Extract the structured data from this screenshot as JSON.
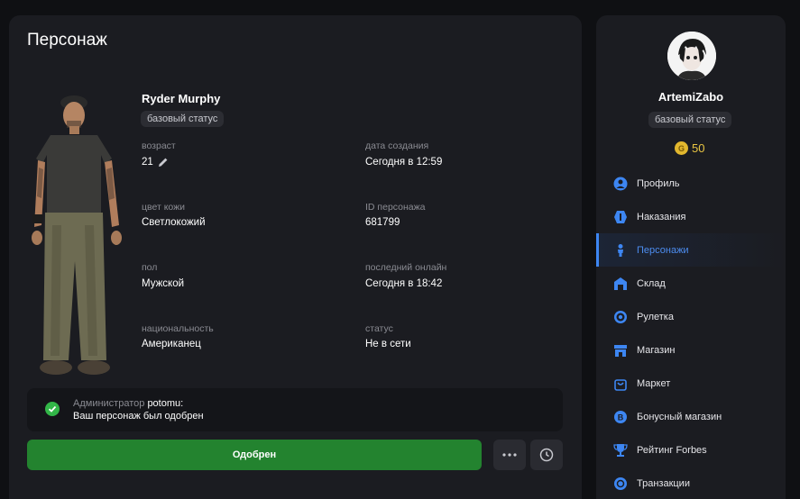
{
  "page": {
    "title": "Персонаж"
  },
  "character": {
    "name": "Ryder Murphy",
    "status_badge": "базовый статус",
    "fields": {
      "age": {
        "label": "возраст",
        "value": "21"
      },
      "created": {
        "label": "дата создания",
        "value": "Сегодня в 12:59"
      },
      "skin": {
        "label": "цвет кожи",
        "value": "Светлокожий"
      },
      "id": {
        "label": "ID персонажа",
        "value": "681799"
      },
      "gender": {
        "label": "пол",
        "value": "Мужской"
      },
      "last_online": {
        "label": "последний онлайн",
        "value": "Сегодня в 18:42"
      },
      "nationality": {
        "label": "национальность",
        "value": "Американец"
      },
      "status": {
        "label": "статус",
        "value": "Не в сети"
      }
    }
  },
  "notice": {
    "prefix": "Администратор",
    "admin": "potomu",
    "suffix": ":",
    "message": "Ваш персонаж был одобрен"
  },
  "actions": {
    "approve_label": "Одобрен"
  },
  "user": {
    "name": "ArtemiZabo",
    "status_badge": "базовый статус",
    "coins": "50",
    "coin_symbol": "G"
  },
  "nav": [
    {
      "label": "Профиль",
      "icon": "user-circle-icon"
    },
    {
      "label": "Наказания",
      "icon": "punishment-icon"
    },
    {
      "label": "Персонажи",
      "icon": "person-icon",
      "active": true
    },
    {
      "label": "Склад",
      "icon": "warehouse-icon"
    },
    {
      "label": "Рулетка",
      "icon": "roulette-icon"
    },
    {
      "label": "Магазин",
      "icon": "store-icon"
    },
    {
      "label": "Маркет",
      "icon": "shopping-bag-icon"
    },
    {
      "label": "Бонусный магазин",
      "icon": "bonus-icon"
    },
    {
      "label": "Рейтинг Forbes",
      "icon": "trophy-icon"
    },
    {
      "label": "Транзакции",
      "icon": "transactions-icon"
    }
  ],
  "colors": {
    "accent": "#3d86f2",
    "approve": "#23832f",
    "coin": "#e9c543",
    "success": "#32b648"
  }
}
